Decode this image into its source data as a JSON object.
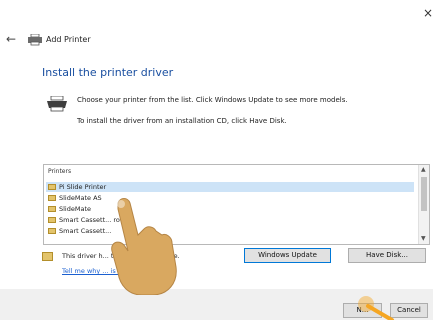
{
  "window": {
    "close_glyph": "×"
  },
  "header": {
    "back_glyph": "←",
    "title": "Add Printer",
    "icon": "printer-icon"
  },
  "main": {
    "heading": "Install the printer driver",
    "info_line1": "Choose your printer from the list. Click Windows Update to see more models.",
    "info_line2": "To install the driver from an installation CD, click Have Disk."
  },
  "printer_list": {
    "header": "Printers",
    "items": [
      {
        "label": "Pi Slide Printer",
        "selected": true
      },
      {
        "label": "SlideMate AS",
        "selected": false
      },
      {
        "label": "SlideMate",
        "selected": false
      },
      {
        "label": "Smart Cassett... rou",
        "selected": false
      },
      {
        "label": "Smart Cassett...",
        "selected": false
      }
    ]
  },
  "signature": {
    "text": "This driver h... ticode(tm) signature.",
    "link": "Tell me why ... is important"
  },
  "buttons": {
    "windows_update": "Windows Update",
    "have_disk": "Have Disk...",
    "next": "N...",
    "cancel": "Cancel"
  },
  "colors": {
    "accent": "#1a4fa0",
    "link": "#1a5fd0",
    "selection": "#cde3f7",
    "hand": "#d9a860",
    "arrow": "#f5a623"
  }
}
